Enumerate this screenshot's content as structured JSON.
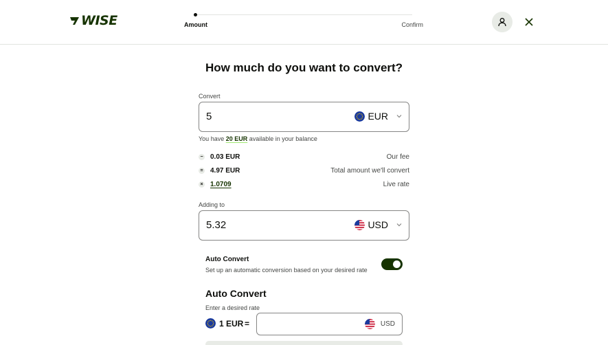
{
  "header": {
    "logo_text": "WISE",
    "steps": [
      "Amount",
      "Confirm"
    ],
    "profile_icon": "user-icon",
    "close_icon": "close-icon"
  },
  "main": {
    "title": "How much do you want to convert?",
    "convert": {
      "label": "Convert",
      "value": "5",
      "currency": "EUR"
    },
    "balance": {
      "prefix": "You have",
      "amount": "20 EUR",
      "suffix": "available in your balance"
    },
    "fees": [
      {
        "symbol": "−",
        "value": "0.03 EUR",
        "desc": "Our fee"
      },
      {
        "symbol": "=",
        "value": "4.97 EUR",
        "desc": "Total amount we'll convert"
      },
      {
        "symbol": "×",
        "value": "1.0709",
        "desc": "Live rate"
      }
    ],
    "adding_to": {
      "label": "Adding to",
      "value": "5.32",
      "currency": "USD"
    },
    "auto_convert": {
      "title": "Auto Convert",
      "subtitle": "Set up an automatic conversion based on your desired rate",
      "enabled": true
    },
    "rate_section": {
      "heading": "Auto Convert",
      "label": "Enter a desired rate",
      "from": "1 EUR",
      "equals": "=",
      "input_value": "",
      "to_currency": "USD"
    }
  },
  "colors": {
    "brand": "#163300",
    "accent": "#9fe870",
    "border": "#868685"
  }
}
